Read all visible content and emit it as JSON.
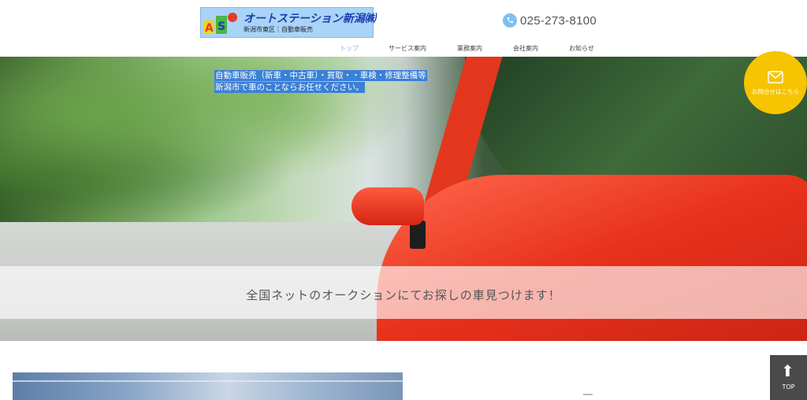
{
  "header": {
    "logo_title": "オートステーション新潟㈱",
    "logo_subtitle": "新潟市東区｜自動車販売",
    "logo_icon": "as-logo-icon",
    "phone_icon": "phone-icon",
    "phone": "025-273-8100"
  },
  "nav": {
    "items": [
      {
        "label": "トップ",
        "active": true
      },
      {
        "label": "サービス案内",
        "active": false
      },
      {
        "label": "業務案内",
        "active": false
      },
      {
        "label": "会社案内",
        "active": false
      },
      {
        "label": "お知らせ",
        "active": false
      }
    ]
  },
  "hero": {
    "lines": [
      "自動車販売（新車・中古車）・買取・・車検・修理整備等",
      "新潟市で車のことならお任せください。"
    ],
    "band_text": "全国ネットのオークションにてお探しの車見つけます！"
  },
  "contact": {
    "icon": "mail-icon",
    "label": "お問合せはこちら"
  },
  "top_button": {
    "icon": "arrow-up-icon",
    "label": "TOP"
  },
  "colors": {
    "accent_yellow": "#f6c400",
    "highlight_blue": "#3b80d8",
    "logo_bg": "#a9d4f7"
  }
}
